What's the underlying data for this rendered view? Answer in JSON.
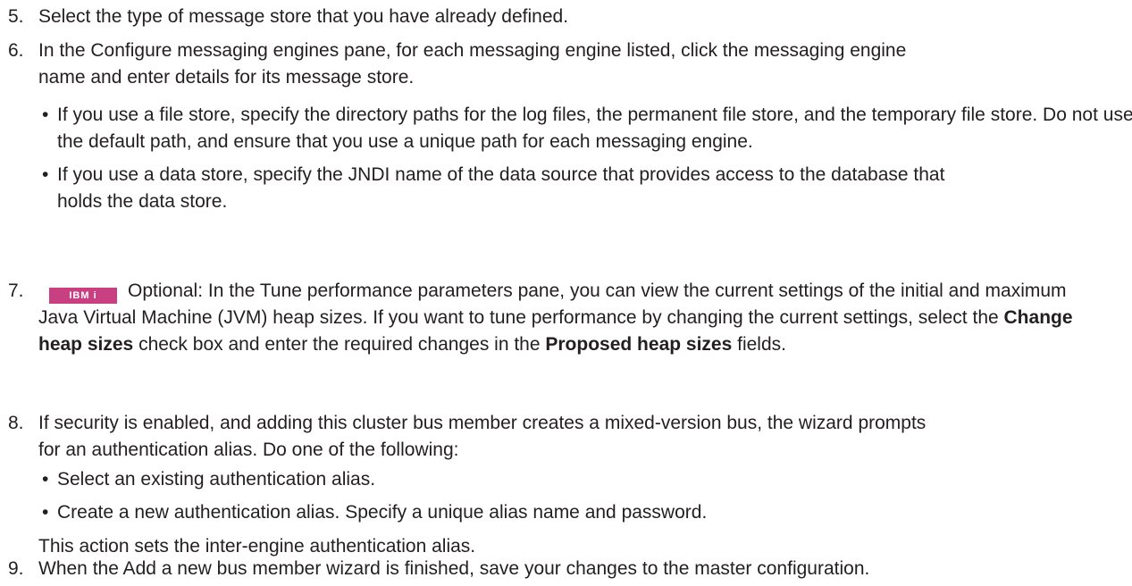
{
  "steps": [
    {
      "num": "5.",
      "text": "Select the type of message store that you have already defined."
    },
    {
      "num": "6.",
      "text": "In the Configure messaging engines pane, for each messaging engine listed, click the messaging engine name and enter details for its message store.",
      "bullets": [
        "If you use a file store, specify the directory paths for the log files, the permanent file store, and the temporary file store. Do not use the default path, and ensure that you use a unique path for each messaging engine.",
        "If you use a data store, specify the JNDI name of the data source that provides access to the database that holds the data store."
      ]
    },
    {
      "num": "7.",
      "badge": "IBM i",
      "text_a": "Optional: In the Tune performance parameters pane, you can view the current settings of the initial and maximum Java Virtual Machine (JVM) heap sizes. If you want to tune performance by changing the current settings, select the ",
      "bold_a": "Change heap sizes",
      "text_b": " check box and enter the required changes in the ",
      "bold_b": "Proposed heap sizes",
      "text_c": " fields."
    },
    {
      "num": "8.",
      "text": "If security is enabled, and adding this cluster bus member creates a mixed-version bus, the wizard prompts for an authentication alias. Do one of the following:",
      "bullets": [
        "Select an existing authentication alias.",
        "Create a new authentication alias. Specify a unique alias name and password."
      ],
      "note": "This action sets the inter-engine authentication alias."
    },
    {
      "num": "9.",
      "text": "When the Add a new bus member wizard is finished, save your changes to the master configuration."
    }
  ],
  "bullet_char": "•"
}
